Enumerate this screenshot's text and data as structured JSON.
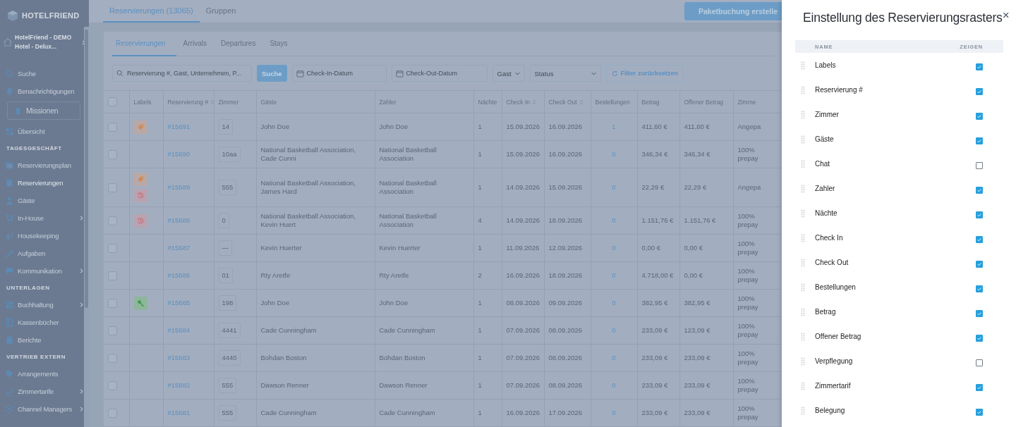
{
  "sidebar": {
    "brand": "HOTELFRIEND",
    "hotel": "HotelFriend - DEMO Hotel - Delux...",
    "items": [
      {
        "kind": "item",
        "label": "Suche",
        "selected": false,
        "submenu": false
      },
      {
        "kind": "item",
        "label": "Benachrichtigungen",
        "selected": false,
        "submenu": false
      },
      {
        "kind": "boxed",
        "label": "Missionen",
        "selected": false,
        "submenu": false
      },
      {
        "kind": "item",
        "label": "Übersicht",
        "selected": false,
        "submenu": false
      },
      {
        "kind": "heading",
        "label": "TAGESGESCHÄFT"
      },
      {
        "kind": "item",
        "label": "Reservierungsplan",
        "selected": false,
        "submenu": false
      },
      {
        "kind": "item",
        "label": "Reservierungen",
        "selected": true,
        "submenu": false
      },
      {
        "kind": "item",
        "label": "Gäste",
        "selected": false,
        "submenu": false
      },
      {
        "kind": "item",
        "label": "In-House",
        "selected": false,
        "submenu": true
      },
      {
        "kind": "item",
        "label": "Housekeeping",
        "selected": false,
        "submenu": false
      },
      {
        "kind": "item",
        "label": "Aufgaben",
        "selected": false,
        "submenu": false
      },
      {
        "kind": "item",
        "label": "Kommunikation",
        "selected": false,
        "submenu": true
      },
      {
        "kind": "heading",
        "label": "UNTERLAGEN"
      },
      {
        "kind": "item",
        "label": "Buchhaltung",
        "selected": false,
        "submenu": true
      },
      {
        "kind": "item",
        "label": "Kassenbücher",
        "selected": false,
        "submenu": false
      },
      {
        "kind": "item",
        "label": "Berichte",
        "selected": false,
        "submenu": false
      },
      {
        "kind": "heading",
        "label": "VERTRIEB EXTERN"
      },
      {
        "kind": "item",
        "label": "Arrangements",
        "selected": false,
        "submenu": false
      },
      {
        "kind": "item",
        "label": "Zimmertarife",
        "selected": false,
        "submenu": true
      },
      {
        "kind": "item",
        "label": "Channel Managers",
        "selected": false,
        "submenu": true
      }
    ]
  },
  "top_tabs": [
    {
      "label": "Reservierungen (13065)",
      "selected": true
    },
    {
      "label": "Gruppen",
      "selected": false
    }
  ],
  "create_button": "Paketbuchung erstelle",
  "sub_tabs": [
    {
      "label": "Reservierungen",
      "selected": true
    },
    {
      "label": "Arrivals",
      "selected": false
    },
    {
      "label": "Departures",
      "selected": false
    },
    {
      "label": "Stays",
      "selected": false
    }
  ],
  "filters": {
    "search_placeholder": "Reservierung #, Gast, Unternehmen, P...",
    "search_button": "Suche",
    "check_in_placeholder": "Check-In-Datum",
    "check_out_placeholder": "Check-Out-Datum",
    "guest_select": "Gast",
    "status_placeholder": "Status",
    "reset_button": "Filter zurücksetzen"
  },
  "table": {
    "select_all_checked": false,
    "columns": [
      {
        "label": "Labels",
        "sortable": false
      },
      {
        "label": "Reservierung #",
        "sortable": true
      },
      {
        "label": "Zimmer",
        "sortable": false
      },
      {
        "label": "Gäste",
        "sortable": false
      },
      {
        "label": "Zahler",
        "sortable": false
      },
      {
        "label": "Nächte",
        "sortable": false
      },
      {
        "label": "Check In",
        "sortable": true
      },
      {
        "label": "Check Out",
        "sortable": true
      },
      {
        "label": "Bestellungen",
        "sortable": false
      },
      {
        "label": "Betrag",
        "sortable": false
      },
      {
        "label": "Offener Betrag",
        "sortable": false
      },
      {
        "label": "Zimme",
        "sortable": false
      }
    ],
    "rows": [
      {
        "selected": false,
        "labels": [
          {
            "kind": "tag"
          }
        ],
        "number": "#15691",
        "room": "14",
        "guests": "John Doe",
        "payer": "John Doe",
        "nights": "1",
        "check_in": "15.09.2026",
        "check_out": "16.09.2026",
        "orders": "1",
        "amount": "411,60 €",
        "open_amount": "411,60 €",
        "column_13": "Angepa"
      },
      {
        "selected": false,
        "labels": [],
        "number": "#15690",
        "room": "10aa",
        "guests": "National Basketball Association, Cade Cunni",
        "payer": "National Basketball Association",
        "nights": "1",
        "check_in": "15.09.2026",
        "check_out": "16.09.2026",
        "orders": "0",
        "amount": "346,34 €",
        "open_amount": "346,34 €",
        "column_13": "100% prepay"
      },
      {
        "selected": false,
        "labels": [
          {
            "kind": "tag"
          },
          {
            "kind": "history"
          }
        ],
        "number": "#15689",
        "room": "555",
        "guests": "National Basketball Association, James Hard",
        "payer": "National Basketball Association",
        "nights": "1",
        "check_in": "14.09.2026",
        "check_out": "15.09.2026",
        "orders": "0",
        "amount": "22,29 €",
        "open_amount": "22,29 €",
        "column_13": "Angepa"
      },
      {
        "selected": false,
        "labels": [
          {
            "kind": "history"
          }
        ],
        "number": "#15688",
        "room": "0",
        "guests": "National Basketball Association, Kevin Huert",
        "payer": "National Basketball Association",
        "nights": "4",
        "check_in": "14.09.2026",
        "check_out": "18.09.2026",
        "orders": "0",
        "amount": "1.151,76 €",
        "open_amount": "1.151,76 €",
        "column_13": "100% prepay"
      },
      {
        "selected": false,
        "labels": [],
        "number": "#15687",
        "room": "—",
        "guests": "Kevin Huerter",
        "payer": "Kevin Huerter",
        "nights": "1",
        "check_in": "11.09.2026",
        "check_out": "12.09.2026",
        "orders": "0",
        "amount": "0,00 €",
        "open_amount": "0,00 €",
        "column_13": "100% prepay"
      },
      {
        "selected": false,
        "labels": [],
        "number": "#15686",
        "room": "01",
        "guests": "Rty Aretfe",
        "payer": "Rty Aretfe",
        "nights": "2",
        "check_in": "16.09.2026",
        "check_out": "18.09.2026",
        "orders": "0",
        "amount": "4.718,00 €",
        "open_amount": "0,00 €",
        "column_13": "100% prepay"
      },
      {
        "selected": false,
        "labels": [
          {
            "kind": "key"
          }
        ],
        "number": "#15685",
        "room": "198",
        "guests": "John Doe",
        "payer": "John Doe",
        "nights": "1",
        "check_in": "08.09.2026",
        "check_out": "09.09.2026",
        "orders": "0",
        "amount": "382,95 €",
        "open_amount": "382,95 €",
        "column_13": "100% prepay"
      },
      {
        "selected": false,
        "labels": [],
        "number": "#15684",
        "room": "4441",
        "guests": "Cade Cunningham",
        "payer": "Cade Cunningham",
        "nights": "1",
        "check_in": "07.09.2026",
        "check_out": "08.09.2026",
        "orders": "0",
        "amount": "233,09 €",
        "open_amount": "123,09 €",
        "column_13": "100% prepay"
      },
      {
        "selected": false,
        "labels": [],
        "number": "#15683",
        "room": "4440",
        "guests": "Bohdan Boston",
        "payer": "Bohdan Boston",
        "nights": "1",
        "check_in": "07.09.2026",
        "check_out": "08.09.2026",
        "orders": "0",
        "amount": "233,09 €",
        "open_amount": "233,09 €",
        "column_13": "100% prepay"
      },
      {
        "selected": false,
        "labels": [],
        "number": "#15682",
        "room": "555",
        "guests": "Dawson Renner",
        "payer": "Dawson Renner",
        "nights": "1",
        "check_in": "07.09.2026",
        "check_out": "08.09.2026",
        "orders": "0",
        "amount": "233,09 €",
        "open_amount": "233,09 €",
        "column_13": "100% prepay"
      },
      {
        "selected": false,
        "labels": [],
        "number": "#15681",
        "room": "555",
        "guests": "Cade Cunningham",
        "payer": "Cade Cunningham",
        "nights": "1",
        "check_in": "16.09.2026",
        "check_out": "17.09.2026",
        "orders": "0",
        "amount": "233,09 €",
        "open_amount": "233,09 €",
        "column_13": "100% prepay"
      }
    ]
  },
  "settings": {
    "title": "Einstellung des Reservierungsrasters",
    "close": "×",
    "name_header": "NAME",
    "show_header": "ZEIGEN",
    "columns": [
      {
        "label": "Labels",
        "checked": true
      },
      {
        "label": "Reservierung #",
        "checked": true
      },
      {
        "label": "Zimmer",
        "checked": true
      },
      {
        "label": "Gäste",
        "checked": true
      },
      {
        "label": "Chat",
        "checked": false
      },
      {
        "label": "Zahler",
        "checked": true
      },
      {
        "label": "Nächte",
        "checked": true
      },
      {
        "label": "Check In",
        "checked": true
      },
      {
        "label": "Check Out",
        "checked": true
      },
      {
        "label": "Bestellungen",
        "checked": true
      },
      {
        "label": "Betrag",
        "checked": true
      },
      {
        "label": "Offener Betrag",
        "checked": true
      },
      {
        "label": "Verpflegung",
        "checked": false
      },
      {
        "label": "Zimmertarif",
        "checked": true
      },
      {
        "label": "Belegung",
        "checked": true
      }
    ]
  }
}
